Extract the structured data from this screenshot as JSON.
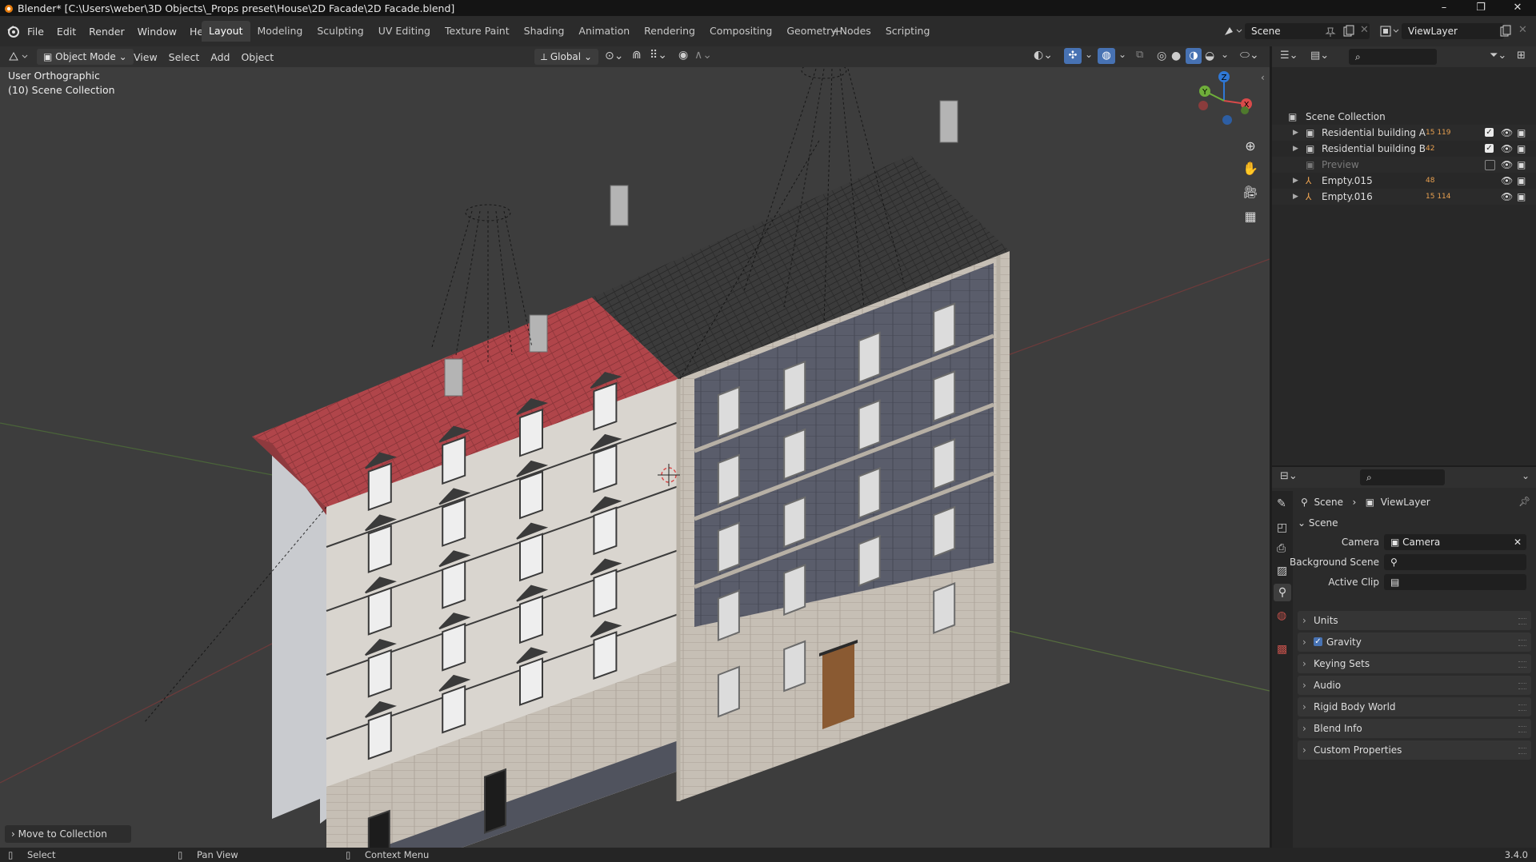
{
  "title_bar": {
    "title": "Blender* [C:\\Users\\weber\\3D Objects\\_Props preset\\House\\2D Facade\\2D Facade.blend]",
    "minimize": "–",
    "maximize": "❐",
    "close": "✕"
  },
  "menu": {
    "file": "File",
    "edit": "Edit",
    "render": "Render",
    "window": "Window",
    "help": "Help"
  },
  "workspaces": [
    "Layout",
    "Modeling",
    "Sculpting",
    "UV Editing",
    "Texture Paint",
    "Shading",
    "Animation",
    "Rendering",
    "Compositing",
    "Geometry Nodes",
    "Scripting"
  ],
  "active_workspace": "Layout",
  "add_workspace": "+",
  "scene_field": "Scene",
  "viewlayer_field": "ViewLayer",
  "viewport_header": {
    "mode": "Object Mode",
    "view": "View",
    "select": "Select",
    "add": "Add",
    "object": "Object",
    "orientation": "Global"
  },
  "viewport_info": {
    "line1": "User Orthographic",
    "line2": "(10) Scene Collection"
  },
  "gizmo": {
    "z": "Z",
    "y": "Y",
    "x": "X"
  },
  "last_operator": "Move to Collection",
  "outliner": {
    "root": "Scene Collection",
    "items": [
      {
        "name": "Residential building A",
        "badge": "15 119",
        "checked": true
      },
      {
        "name": "Residential building B",
        "badge": "42",
        "checked": true
      },
      {
        "name": "Preview",
        "badge": "",
        "checked": false
      },
      {
        "name": "Empty.015",
        "badge": "48",
        "checked": null
      },
      {
        "name": "Empty.016",
        "badge": "15 114",
        "checked": null
      }
    ]
  },
  "properties": {
    "breadcrumb_scene": "Scene",
    "breadcrumb_layer": "ViewLayer",
    "section": "Scene",
    "camera_label": "Camera",
    "camera_value": "Camera",
    "bg_scene_label": "Background Scene",
    "active_clip_label": "Active Clip",
    "panels": [
      "Units",
      "Gravity",
      "Keying Sets",
      "Audio",
      "Rigid Body World",
      "Blend Info",
      "Custom Properties"
    ]
  },
  "status_bar": {
    "select": "Select",
    "pan": "Pan View",
    "context": "Context Menu",
    "version": "3.4.0"
  },
  "colors": {
    "roof_red": "#b0454a",
    "roof_dark": "#3a3a3a",
    "facade_light": "#d9d5cf",
    "facade_blue": "#57596b",
    "brick": "#c9c2b8",
    "door": "#8a5a32"
  }
}
